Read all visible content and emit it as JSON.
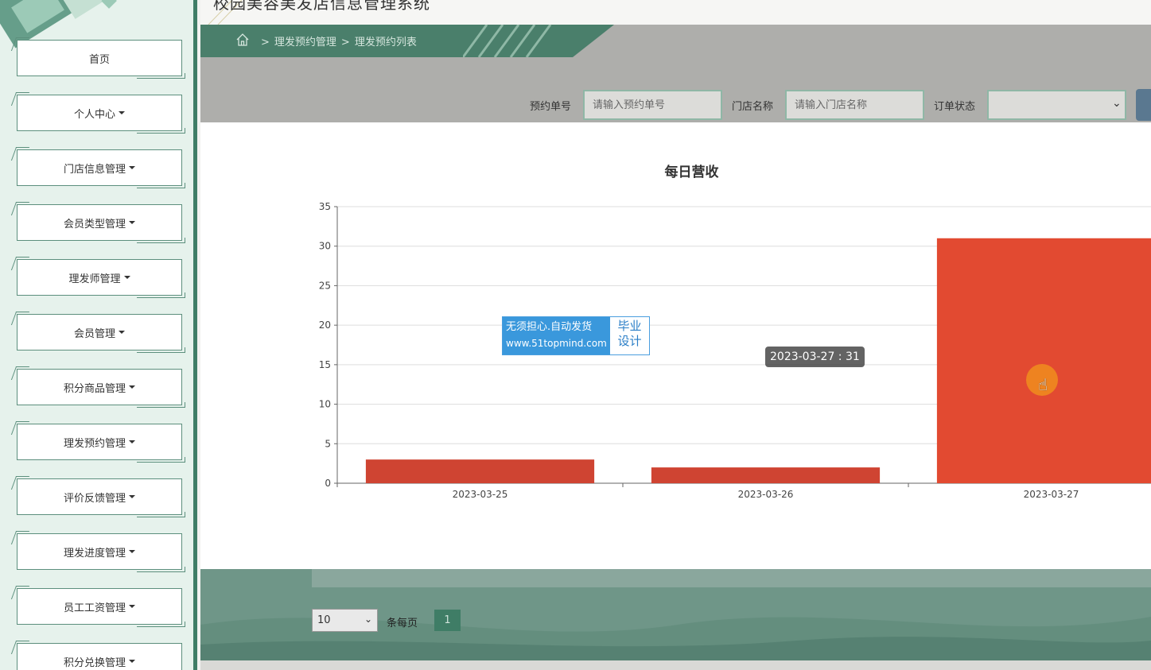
{
  "header": {
    "title": "校园美容美发店信息管理系统"
  },
  "sidebar": {
    "items": [
      {
        "label": "首页",
        "caret": false
      },
      {
        "label": "个人中心",
        "caret": true
      },
      {
        "label": "门店信息管理",
        "caret": true
      },
      {
        "label": "会员类型管理",
        "caret": true
      },
      {
        "label": "理发师管理",
        "caret": true
      },
      {
        "label": "会员管理",
        "caret": true
      },
      {
        "label": "积分商品管理",
        "caret": true
      },
      {
        "label": "理发预约管理",
        "caret": true
      },
      {
        "label": "评价反馈管理",
        "caret": true
      },
      {
        "label": "理发进度管理",
        "caret": true
      },
      {
        "label": "员工工资管理",
        "caret": true
      },
      {
        "label": "积分兑换管理",
        "caret": true
      }
    ]
  },
  "breadcrumb": {
    "sep": ">",
    "level1": "理发预约管理",
    "level2": "理发预约列表"
  },
  "search": {
    "order_no_label": "预约单号",
    "order_no_placeholder": "请输入预约单号",
    "store_label": "门店名称",
    "store_placeholder": "请输入门店名称",
    "status_label": "订单状态",
    "status_value": ""
  },
  "chart_data": {
    "type": "bar",
    "title": "每日营收",
    "categories": [
      "2023-03-25",
      "2023-03-26",
      "2023-03-27"
    ],
    "values": [
      3,
      2,
      31
    ],
    "ylim": [
      0,
      35
    ],
    "yticks": [
      0,
      5,
      10,
      15,
      20,
      25,
      30,
      35
    ],
    "grid": true,
    "bar_colors": [
      "#cf4432",
      "#cf4432",
      "#e24a31"
    ],
    "tooltip": "2023-03-27 : 31"
  },
  "watermark": {
    "line1": "无须担心.自动发货",
    "line2": "www.51topmind.com",
    "right1": "毕业",
    "right2": "设计"
  },
  "pagination": {
    "page_size": "10",
    "per_page_label": "条每页",
    "current_page": "1"
  }
}
